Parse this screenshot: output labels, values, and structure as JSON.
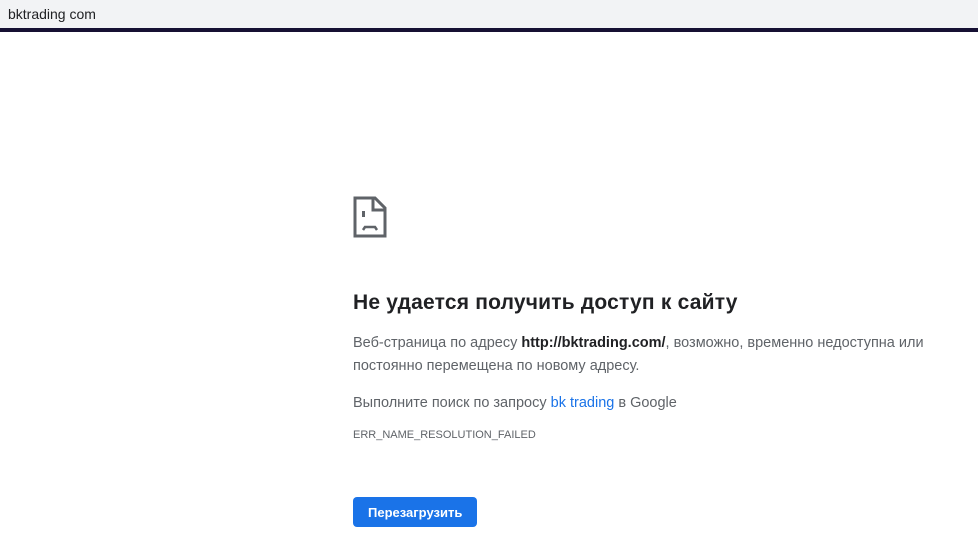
{
  "address_bar": {
    "url": "bktrading com"
  },
  "error": {
    "title": "Не удается получить доступ к сайту",
    "desc_prefix": "Веб-страница по адресу ",
    "desc_url": "http://bktrading.com/",
    "desc_suffix": ", возможно, временно недоступна или постоянно перемещена по новому адресу.",
    "search_prefix": "Выполните поиск по запросу ",
    "search_link": "bk trading",
    "search_suffix": " в Google",
    "code": "ERR_NAME_RESOLUTION_FAILED",
    "reload_label": "Перезагрузить"
  },
  "colors": {
    "accent": "#1a73e8",
    "topline": "#161033"
  }
}
